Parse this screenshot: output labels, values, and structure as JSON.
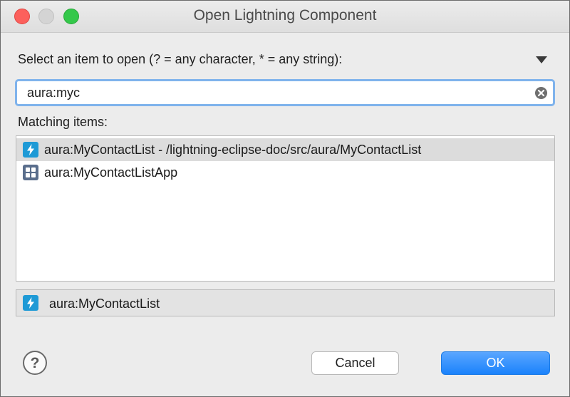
{
  "window": {
    "title": "Open Lightning Component"
  },
  "prompt": {
    "label": "Select an item to open (? = any character, * = any string):"
  },
  "search": {
    "value": "aura:myc"
  },
  "matching": {
    "label": "Matching items:",
    "items": [
      {
        "label": "aura:MyContactList - /lightning-eclipse-doc/src/aura/MyContactList",
        "icon": "lightning-bolt-icon",
        "selected": true
      },
      {
        "label": "aura:MyContactListApp",
        "icon": "app-grid-icon",
        "selected": false
      }
    ]
  },
  "detail": {
    "label": "aura:MyContactList",
    "icon": "lightning-bolt-icon"
  },
  "buttons": {
    "cancel": "Cancel",
    "ok": "OK"
  },
  "colors": {
    "lightning_icon": "#1e9ad6",
    "app_icon": "#5a6e8c",
    "ok_button": "#1a82fb",
    "focus_ring": "#7fb3ec"
  }
}
